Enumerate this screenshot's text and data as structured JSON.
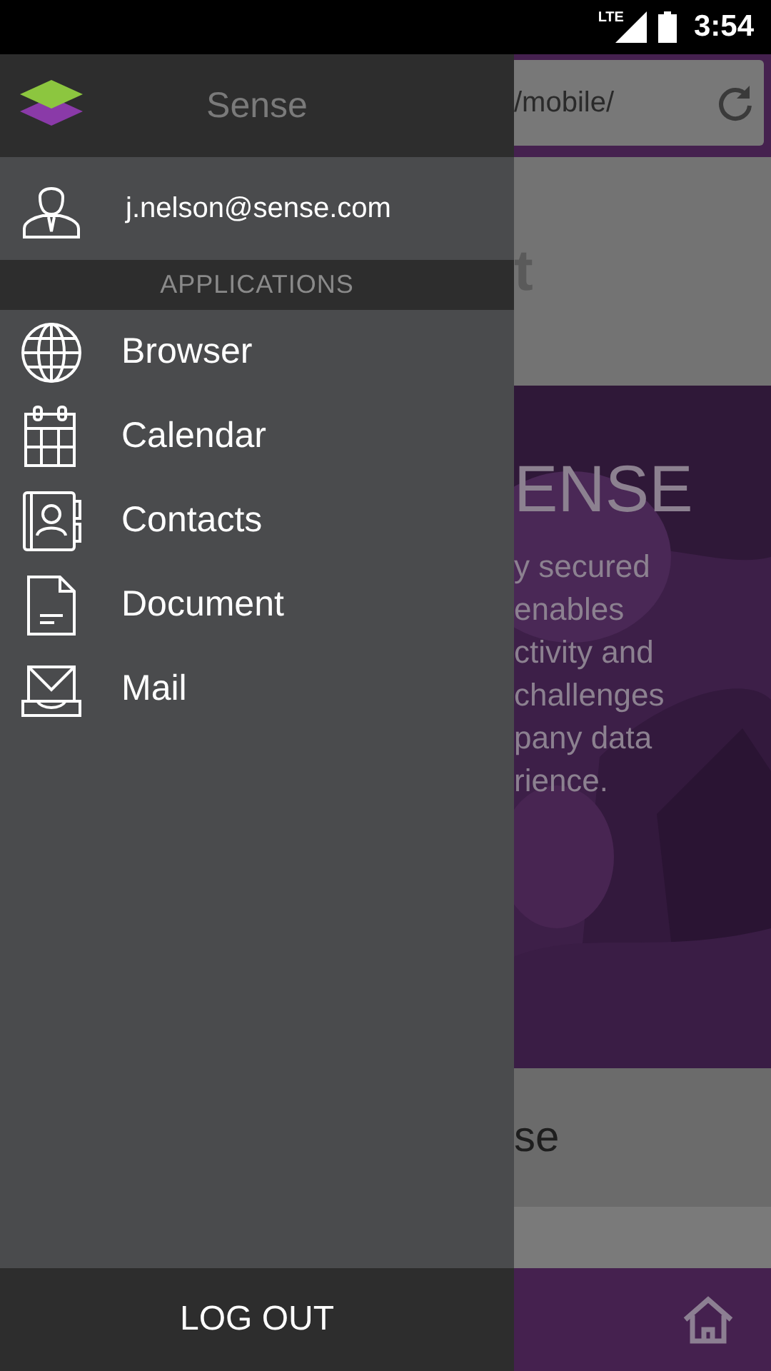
{
  "status_bar": {
    "network": "LTE",
    "time": "3:54"
  },
  "drawer": {
    "title": "Sense",
    "account": "j.nelson@sense.com",
    "section_header": "APPLICATIONS",
    "items": [
      {
        "label": "Browser",
        "kind": "globe"
      },
      {
        "label": "Calendar",
        "kind": "calendar"
      },
      {
        "label": "Contacts",
        "kind": "contacts"
      },
      {
        "label": "Document",
        "kind": "document"
      },
      {
        "label": "Mail",
        "kind": "mail"
      }
    ],
    "logout": "LOG OUT"
  },
  "background_page": {
    "address": "/mobile/",
    "heading_fragment": "t",
    "hero_title": "ENSE",
    "hero_lines": [
      "y secured",
      "enables",
      "ctivity and",
      "challenges",
      "pany data",
      "rience."
    ],
    "card_text": "se"
  }
}
